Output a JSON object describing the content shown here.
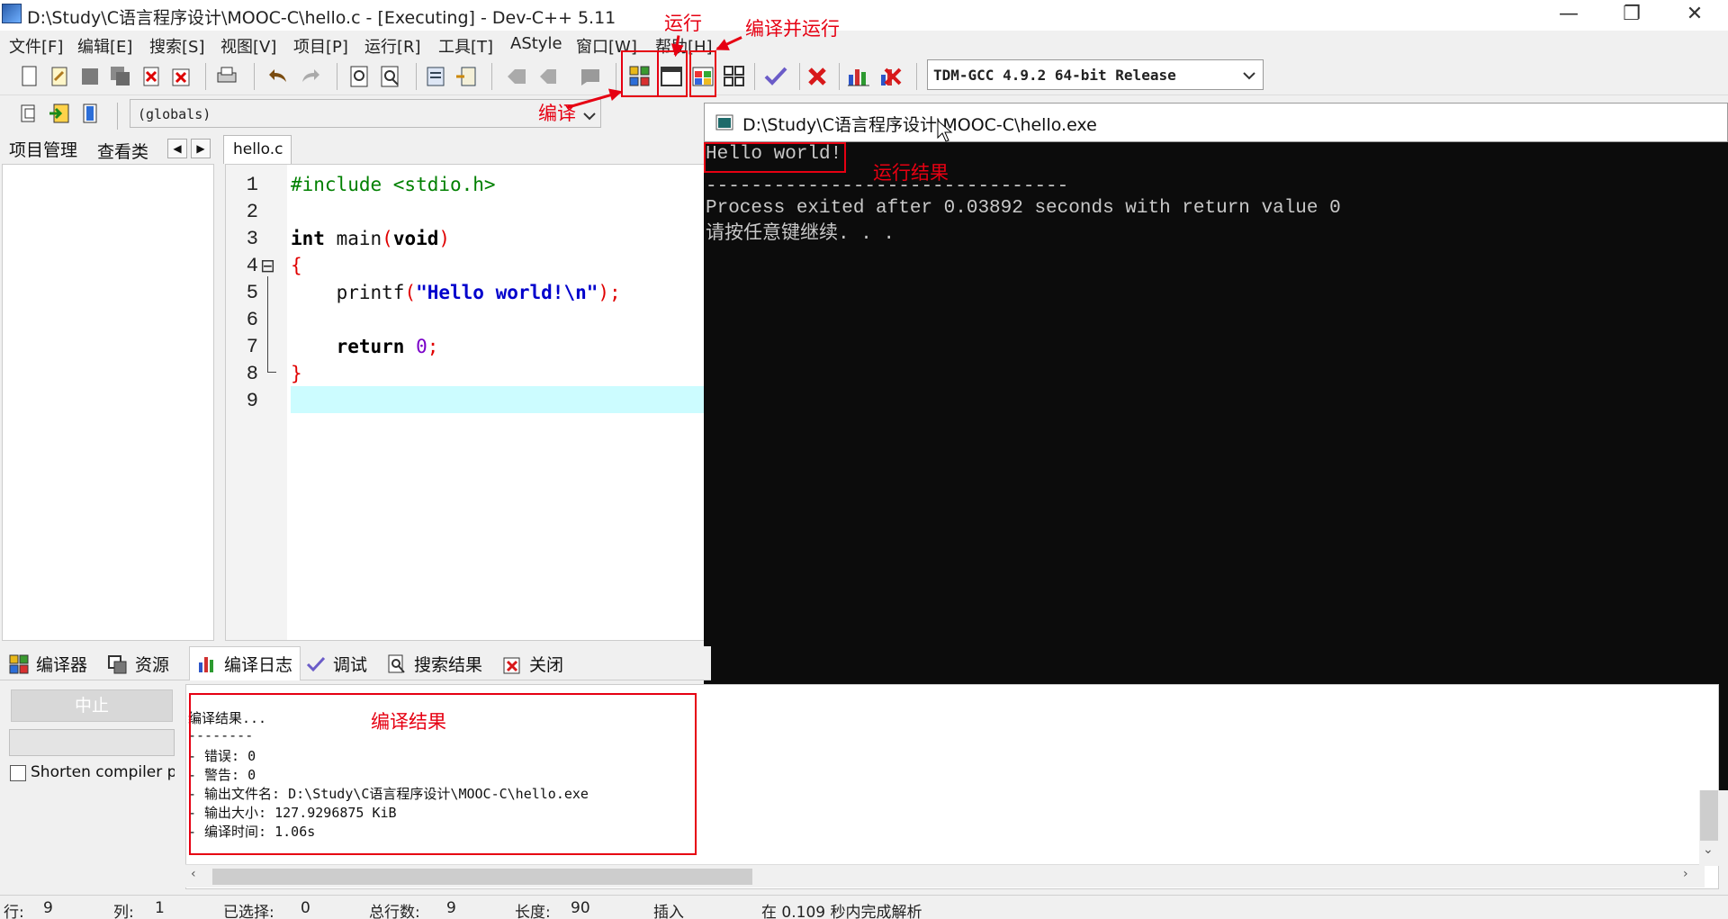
{
  "window": {
    "title": "D:\\Study\\C语言程序设计\\MOOC-C\\hello.c - [Executing] - Dev-C++ 5.11",
    "minimize_glyph": "—",
    "restore_glyph": "❐",
    "close_glyph": "✕"
  },
  "menu": [
    "文件[F]",
    "编辑[E]",
    "搜索[S]",
    "视图[V]",
    "项目[P]",
    "运行[R]",
    "工具[T]",
    "AStyle",
    "窗口[W]",
    "帮助[H]"
  ],
  "toolbar": {
    "compiler": "TDM-GCC 4.9.2 64-bit Release",
    "scope": "(globals)"
  },
  "left_tabs": [
    "项目管理",
    "查看类"
  ],
  "editor": {
    "file_tab": "hello.c",
    "line_numbers": [
      "1",
      "2",
      "3",
      "4",
      "5",
      "6",
      "7",
      "8",
      "9"
    ],
    "code": {
      "include": "#include <stdio.h>",
      "int_kw": "int",
      "main_sig": " main",
      "paren_open": "(",
      "void_kw": "void",
      "paren_close": ")",
      "brace_open": "{",
      "printf_fn": "    printf",
      "printf_paren_open": "(",
      "printf_str": "\"Hello world!\\n\"",
      "printf_end": ");",
      "return_kw": "    return",
      "return_val": " 0",
      "return_end": ";",
      "brace_close": "}"
    },
    "fold_glyph": "⊟"
  },
  "console": {
    "title": "D:\\Study\\C语言程序设计\\MOOC-C\\hello.exe",
    "lines": [
      "Hello world!",
      "",
      "--------------------------------",
      "Process exited after 0.03892 seconds with return value 0",
      "请按任意键继续. . ."
    ]
  },
  "bottom_tabs": [
    "编译器",
    "资源",
    "编译日志",
    "调试",
    "搜索结果",
    "关闭"
  ],
  "bottom_panel": {
    "stop_label": "中止",
    "shorten_label": "Shorten compiler paths",
    "log_lines": [
      "编译结果...",
      "--------",
      "- 错误: 0",
      "- 警告: 0",
      "- 输出文件名: D:\\Study\\C语言程序设计\\MOOC-C\\hello.exe",
      "- 输出大小: 127.9296875 KiB",
      "- 编译时间: 1.06s"
    ]
  },
  "status": {
    "row_label": "行:",
    "row_value": "9",
    "col_label": "列:",
    "col_value": "1",
    "sel_label": "已选择:",
    "sel_value": "0",
    "lines_label": "总行数:",
    "lines_value": "9",
    "len_label": "长度:",
    "len_value": "90",
    "mode": "插入",
    "parse": "在 0.109 秒内完成解析"
  },
  "annotations": {
    "run": "运行",
    "compile_run": "编译并运行",
    "compile": "编译",
    "run_result": "运行结果",
    "compile_result": "编译结果"
  },
  "colors": {
    "annotation": "#e60012",
    "console_bg": "#0c0c0c",
    "current_line": "#ccfcff"
  }
}
